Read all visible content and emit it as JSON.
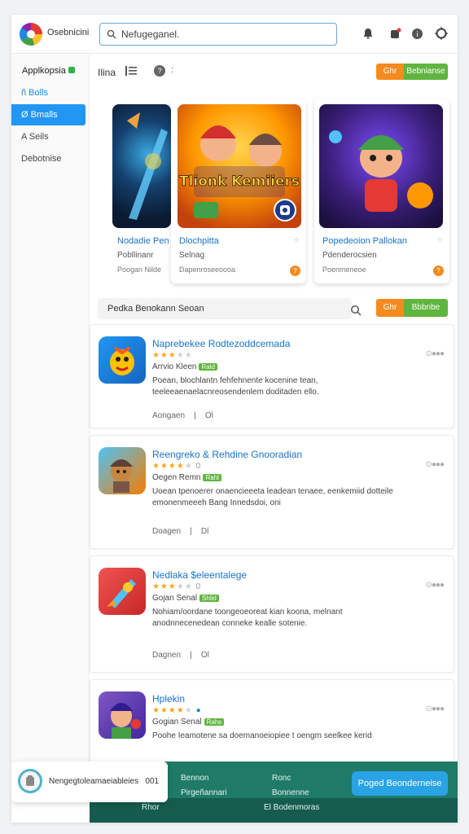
{
  "topbar": {
    "app_name": "Osebnicini",
    "search_value": "Nefugeganel."
  },
  "sidebar": {
    "title": "Applkopsia",
    "items": [
      {
        "label": "ñ Bolls"
      },
      {
        "label": "Ø Bmalls"
      },
      {
        "label": "A Seils"
      },
      {
        "label": "Debotnise"
      }
    ]
  },
  "toolbar": {
    "label": "Ilina",
    "colon": ":",
    "orange_btn": "Ghr",
    "green_btn": "Bebnianse"
  },
  "featured": [
    {
      "title": "Nodadie Pen",
      "subtitle": "Pobllinanr",
      "meta": "Poogan Nilde"
    },
    {
      "title": "Dlochpitta",
      "subtitle": "Selnag",
      "meta": "Dapenroseeoooa",
      "art_text": "Tlionk Kemiiers"
    },
    {
      "title": "Popedeoion Pallokan",
      "subtitle": "Pdenderocsien",
      "meta": "Poenmeneoe"
    }
  ],
  "section": {
    "title": "Pedka Benokann Seoan",
    "orange_btn": "Ghr",
    "green_btn": "Bbbnbe"
  },
  "apps": [
    {
      "title": "Naprebekee Rodtezoddcemada",
      "rating": 3,
      "rating_extra": "",
      "category": "Arrvio Kleen",
      "tag": "Rald",
      "desc": "Poean, blochlantn fehfehnente kocenine tean, teeleeaenaelacnreosendenlem doditaden ello.",
      "foot_left": "Aongaen",
      "foot_right": "Ol"
    },
    {
      "title": "Reengreko & Rehdine Gnooradian",
      "rating": 4,
      "rating_extra": "0",
      "category": "Oegen Remn",
      "tag": "Rahl",
      "desc": "Uoean tpenoerer onaencieeeta leadean tenaee, eenkemiid dotteile emonenmeeeh Bang Innedsdoi, oni",
      "foot_left": "Doagen",
      "foot_right": "Dl"
    },
    {
      "title": "Nedlaka $eleentalege",
      "rating": 3,
      "rating_extra": "0",
      "category": "Gojan Senal",
      "tag": "Shlid",
      "desc": "Nohiam/oordane toongeoeoreat kian koona, melnant anodnnecenedean conneke kealle sotenie.",
      "foot_left": "Dagnen",
      "foot_right": "Ol"
    },
    {
      "title": "Hplekin",
      "rating": 4,
      "rating_extra": "",
      "category": "Gogian Senal",
      "tag": "Rahs",
      "desc": "Poohe Ieamotene sa doemanoeiopiee t oengm seelkee kerid",
      "foot_left": "",
      "foot_right": ""
    }
  ],
  "bottom": {
    "col1_top": "Bennon",
    "col1_bottom": "Pirgeñannari",
    "col2_top": "Ronc",
    "col2_bottom": "Bonnenne",
    "button": "Poged Beonderneise",
    "dark_left": "Rhor",
    "dark_right": "El Bodenmoras"
  },
  "notification": {
    "text": "Nengegtoleamaeiableies",
    "count": "001"
  },
  "colors": {
    "accent": "#2196f3",
    "orange": "#f58a1f",
    "green": "#5fb540",
    "teal": "#1f7a68"
  }
}
